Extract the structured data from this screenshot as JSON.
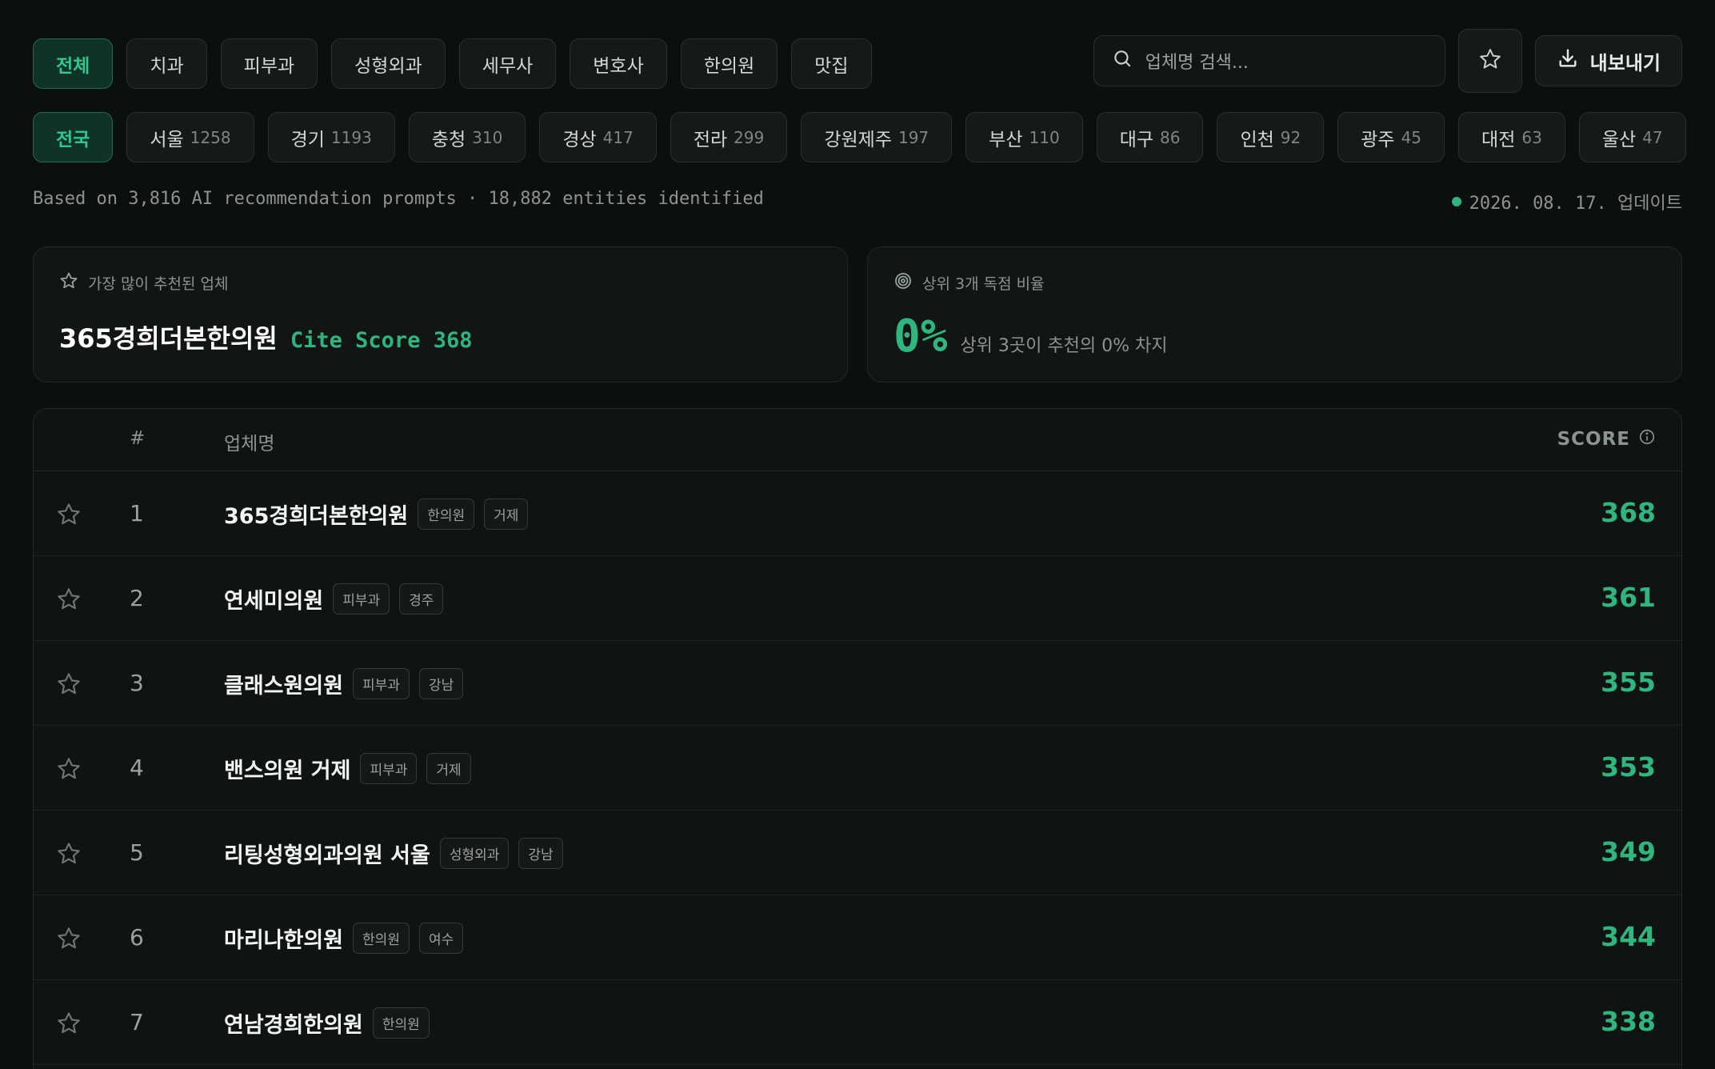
{
  "filters": {
    "categories": [
      {
        "label": "전체",
        "active": true
      },
      {
        "label": "치과"
      },
      {
        "label": "피부과"
      },
      {
        "label": "성형외과"
      },
      {
        "label": "세무사"
      },
      {
        "label": "변호사"
      },
      {
        "label": "한의원"
      },
      {
        "label": "맛집"
      }
    ],
    "regions": [
      {
        "label": "전국",
        "count": "",
        "active": true
      },
      {
        "label": "서울",
        "count": "1258"
      },
      {
        "label": "경기",
        "count": "1193"
      },
      {
        "label": "충청",
        "count": "310"
      },
      {
        "label": "경상",
        "count": "417"
      },
      {
        "label": "전라",
        "count": "299"
      },
      {
        "label": "강원제주",
        "count": "197"
      },
      {
        "label": "부산",
        "count": "110"
      },
      {
        "label": "대구",
        "count": "86"
      },
      {
        "label": "인천",
        "count": "92"
      },
      {
        "label": "광주",
        "count": "45"
      },
      {
        "label": "대전",
        "count": "63"
      },
      {
        "label": "울산",
        "count": "47"
      }
    ]
  },
  "search": {
    "placeholder": "업체명 검색..."
  },
  "toolbar": {
    "export_label": "내보내기"
  },
  "meta": {
    "summary": "Based on 3,816 AI recommendation prompts · 18,882 entities identified",
    "updated": "2026. 08. 17. 업데이트"
  },
  "cards": {
    "top": {
      "label": "가장 많이 추천된 업체",
      "name": "365경희더본한의원",
      "cite": "Cite Score 368"
    },
    "monopoly": {
      "label": "상위 3개 독점 비율",
      "value": "0%",
      "note": "상위 3곳이 추천의 0% 차지"
    }
  },
  "table": {
    "headers": {
      "num": "#",
      "name": "업체명",
      "score": "SCORE"
    },
    "rows": [
      {
        "rank": "1",
        "name": "365경희더본한의원",
        "tags": [
          "한의원",
          "거제"
        ],
        "score": "368"
      },
      {
        "rank": "2",
        "name": "연세미의원",
        "tags": [
          "피부과",
          "경주"
        ],
        "score": "361"
      },
      {
        "rank": "3",
        "name": "클래스원의원",
        "tags": [
          "피부과",
          "강남"
        ],
        "score": "355"
      },
      {
        "rank": "4",
        "name": "밴스의원 거제",
        "tags": [
          "피부과",
          "거제"
        ],
        "score": "353"
      },
      {
        "rank": "5",
        "name": "리팅성형외과의원 서울",
        "tags": [
          "성형외과",
          "강남"
        ],
        "score": "349"
      },
      {
        "rank": "6",
        "name": "마리나한의원",
        "tags": [
          "한의원",
          "여수"
        ],
        "score": "344"
      },
      {
        "rank": "7",
        "name": "연남경희한의원",
        "tags": [
          "한의원"
        ],
        "score": "338"
      }
    ]
  },
  "colors": {
    "accent": "#2fb67f",
    "background": "#0b0f0e",
    "card": "#111614"
  }
}
